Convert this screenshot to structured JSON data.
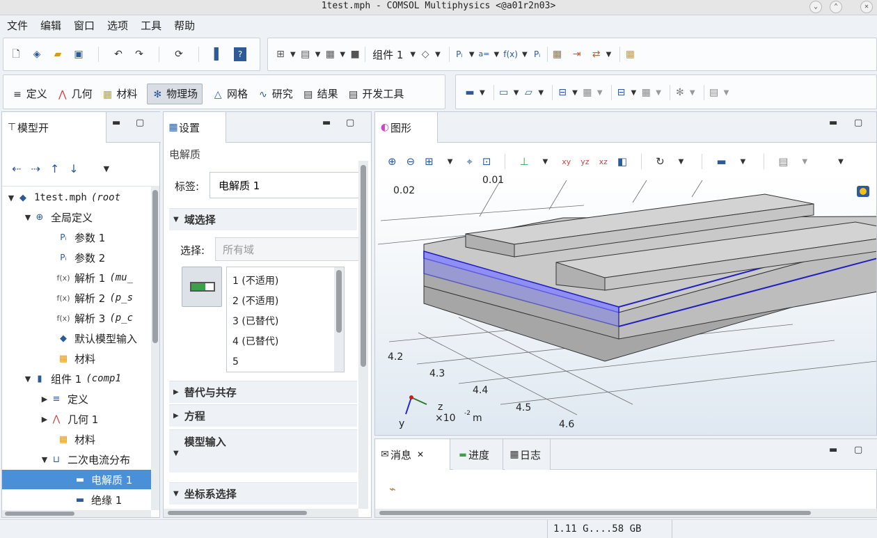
{
  "window": {
    "title": "1test.mph - COMSOL Multiphysics  <@a01r2n03>"
  },
  "menu": [
    "文件",
    "编辑",
    "窗口",
    "选项",
    "工具",
    "帮助"
  ],
  "toolbar": {
    "component_label": "组件 1"
  },
  "ribbon": {
    "tabs": [
      "定义",
      "几何",
      "材料",
      "物理场",
      "网格",
      "研究",
      "结果",
      "开发工具"
    ],
    "active": "物理场"
  },
  "model_builder": {
    "tab": "模型开",
    "tree": [
      {
        "label": "1test.mph",
        "suffix": "(root"
      },
      {
        "label": "全局定义",
        "suffix": ""
      },
      {
        "label": "参数 1",
        "suffix": ""
      },
      {
        "label": "参数 2",
        "suffix": ""
      },
      {
        "label": "解析 1",
        "suffix": "(mu_"
      },
      {
        "label": "解析 2",
        "suffix": "(p_s"
      },
      {
        "label": "解析 3",
        "suffix": "(p_c"
      },
      {
        "label": "默认模型输入",
        "suffix": ""
      },
      {
        "label": "材料",
        "suffix": ""
      },
      {
        "label": "组件 1",
        "suffix": "(comp1"
      },
      {
        "label": "定义",
        "suffix": ""
      },
      {
        "label": "几何 1",
        "suffix": ""
      },
      {
        "label": "材料",
        "suffix": ""
      },
      {
        "label": "二次电流分布",
        "suffix": ""
      },
      {
        "label": "电解质 1",
        "suffix": "",
        "selected": true
      },
      {
        "label": "绝缘 1",
        "suffix": ""
      }
    ]
  },
  "settings": {
    "tab": "设置",
    "heading": "电解质",
    "label_caption": "标签:",
    "label_value": "电解质 1",
    "sections": {
      "domain": "域选择",
      "override": "替代与共存",
      "equation": "方程",
      "model_input": "模型输入",
      "coord": "坐标系选择"
    },
    "selection_caption": "选择:",
    "selection_value": "所有域",
    "domains": [
      "1 (不适用)",
      "2 (不适用)",
      "3 (已替代)",
      "4 (已替代)",
      "5"
    ]
  },
  "graphics": {
    "tab": "图形",
    "axis_labels": {
      "top_z": "0.02",
      "top_cut": "0.01",
      "x_ticks": [
        "4.2",
        "4.3",
        "4.4",
        "4.5",
        "4.6"
      ]
    },
    "triad": {
      "z": "z",
      "y": "y",
      "scale": "×10",
      "exp": "-2",
      "unit": "m"
    }
  },
  "bottom": {
    "tabs": [
      "消息",
      "进度",
      "日志"
    ]
  },
  "status": {
    "memory": "1.11 G....58 GB"
  },
  "colors": {
    "accent": "#4a90d9",
    "selection": "#8e8ef5",
    "edge": "#2020c0",
    "geometry": "#b9b9b9"
  }
}
